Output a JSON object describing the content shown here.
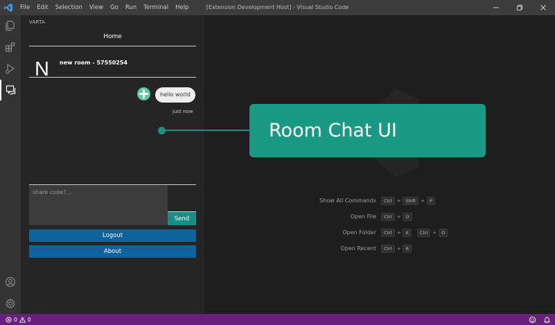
{
  "titlebar": {
    "menu": [
      "File",
      "Edit",
      "Selection",
      "View",
      "Go",
      "Run",
      "Terminal",
      "Help"
    ],
    "title": "[Extension Development Host] - Visual Studio Code"
  },
  "sidebar": {
    "header": "VARTA",
    "home_title": "Home",
    "room": {
      "avatar_letter": "N",
      "name": "new room - 57550254"
    },
    "message": {
      "text": "hello world",
      "time": "just now"
    },
    "input": {
      "placeholder": "share code?..."
    },
    "send_label": "Send",
    "logout_label": "Logout",
    "about_label": "About"
  },
  "editor": {
    "shortcuts": [
      {
        "label": "Show All Commands",
        "keys": [
          "Ctrl",
          "Shift",
          "P"
        ]
      },
      {
        "label": "Open File",
        "keys": [
          "Ctrl",
          "O"
        ]
      },
      {
        "label": "Open Folder",
        "keys": [
          "Ctrl",
          "K"
        ],
        "keys2": [
          "Ctrl",
          "O"
        ]
      },
      {
        "label": "Open Recent",
        "keys": [
          "Ctrl",
          "R"
        ]
      }
    ]
  },
  "callout": {
    "text": "Room Chat UI",
    "color": "#1a9985"
  },
  "statusbar": {
    "errors": "0",
    "warnings": "0",
    "color": "#68217a"
  },
  "icons": {
    "activity": [
      "explorer-icon",
      "extensions-icon",
      "run-debug-icon",
      "chat-icon",
      "account-icon",
      "settings-gear-icon"
    ]
  }
}
